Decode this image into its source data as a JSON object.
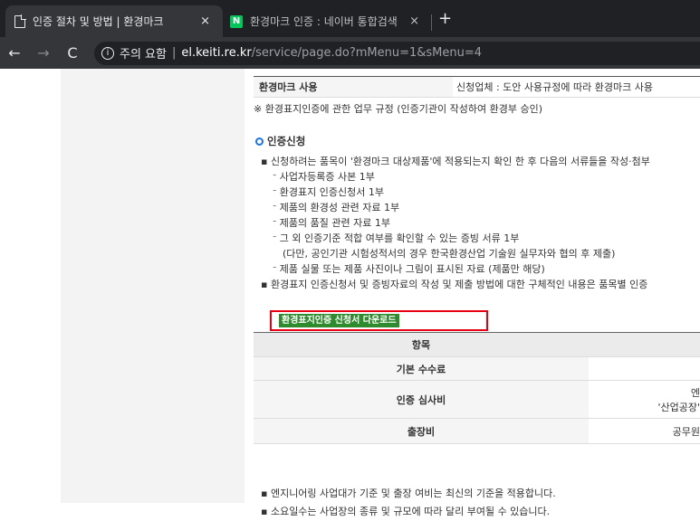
{
  "browser": {
    "tabs": [
      {
        "title": "인증 절차 및 방법 | 환경마크",
        "close": "×"
      },
      {
        "title": "환경마크 인증 : 네이버 통합검색",
        "close": "×",
        "favicon": "N"
      }
    ],
    "new_tab": "+",
    "nav": {
      "back": "←",
      "forward": "→",
      "reload": "C"
    },
    "address": {
      "info_icon": "i",
      "warning": "주의 요함",
      "separator": "|",
      "host": "el.keiti.re.kr",
      "path": "/service/page.do?mMenu=1&sMenu=4"
    }
  },
  "page": {
    "usage_row": {
      "header": "환경마크 사용",
      "value": "신청업체 : 도안 사용규정에 따라 환경마크 사용"
    },
    "note": "※ 환경표지인증에 관한 업무 규정 (인증기관이 작성하여 환경부 승인)",
    "section_title": "인증신청",
    "bullets": [
      {
        "text": "▪ 신청하려는 품목이 '환경마크 대상제품'에 적용되는지 확인 한 후 다음의 서류들을 작성·첨부",
        "level": 0
      },
      {
        "text": "ᐨ 사업자등록증 사본 1부",
        "level": 1
      },
      {
        "text": "ᐨ 환경표지 인증신청서 1부",
        "level": 1
      },
      {
        "text": "ᐨ 제품의 환경성 관련 자료 1부",
        "level": 1
      },
      {
        "text": "ᐨ 제품의 품질 관련 자료 1부",
        "level": 1
      },
      {
        "text": "ᐨ 그 외 인증기준 적합 여부를 확인할 수 있는 증빙 서류 1부",
        "level": 1
      },
      {
        "text": "(다만, 공인기관 시험성적서의 경우 한국환경산업 기술원 실무자와 협의 후 제출)",
        "level": 2
      },
      {
        "text": "ᐨ 제품 실물 또는 제품 사진이나 그림이 표시된 자료 (제품만 해당)",
        "level": 1
      },
      {
        "text": "▪ 환경표지 인증신청서 및 증빙자료의 작성 및 제출 방법에 대한 구체적인 내용은 품목별 인증",
        "level": 0
      }
    ],
    "download_button": "환경표지인증 신청서 다운로드",
    "fee_table": {
      "header": "항목",
      "rows": [
        {
          "label": "기본 수수료",
          "value_line1": "",
          "value_line2": ""
        },
        {
          "label": "인증 심사비",
          "value_line1": "엔",
          "value_line2": "'산업공장'"
        },
        {
          "label": "출장비",
          "value_line1": "공무원",
          "value_line2": ""
        }
      ]
    },
    "footnotes": [
      "▪ 엔지니어링 사업대가 기준 및 출장 여비는 최신의 기준을 적용합니다.",
      "▪ 소요일수는 사업장의 종류 및 규모에 따라 달리 부여될 수 있습니다."
    ]
  }
}
